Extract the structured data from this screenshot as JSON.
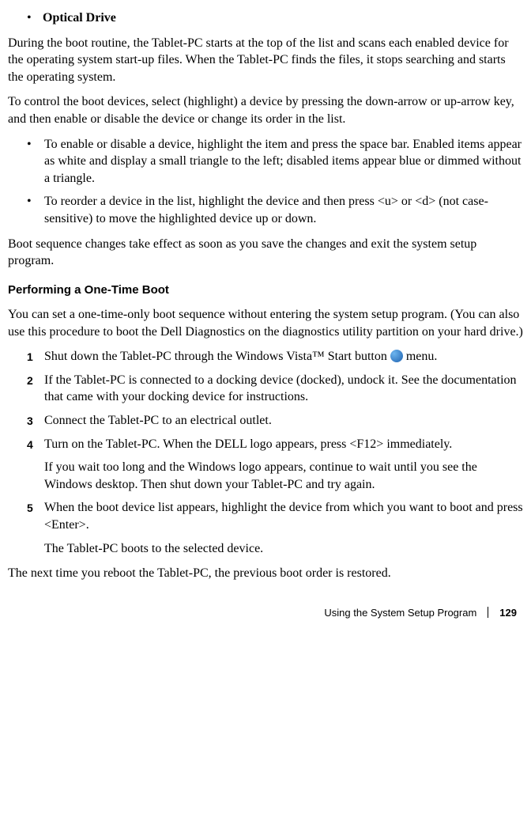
{
  "top_bullet": {
    "marker": "•",
    "label": "Optical Drive"
  },
  "p1": "During the boot routine, the Tablet-PC starts at the top of the list and scans each enabled device for the operating system start-up files. When the Tablet-PC finds the files, it stops searching and starts the operating system.",
  "p2": "To control the boot devices, select (highlight) a device by pressing the down-arrow or up-arrow key, and then enable or disable the device or change its order in the list.",
  "sub_bullets": [
    "To enable or disable a device, highlight the item and press the space bar. Enabled items appear as white and display a small triangle to the left; disabled items appear blue or dimmed without a triangle.",
    "To reorder a device in the list, highlight the device and then press <u> or <d> (not case-sensitive) to move the highlighted device up or down."
  ],
  "p3": "Boot sequence changes take effect as soon as you save the changes and exit the system setup program.",
  "heading": "Performing a One-Time Boot",
  "p4": "You can set a one-time-only boot sequence without entering the system setup program. (You can also use this procedure to boot the Dell Diagnostics on the diagnostics utility partition on your hard drive.)",
  "steps": [
    {
      "num": "1",
      "text_before_icon": "Shut down the Tablet-PC through the Windows Vista™ Start button ",
      "text_after_icon": " menu."
    },
    {
      "num": "2",
      "text": "If the Tablet-PC is connected to a docking device (docked), undock it. See the documentation that came with your docking device for instructions."
    },
    {
      "num": "3",
      "text": "Connect the Tablet-PC to an electrical outlet."
    },
    {
      "num": "4",
      "text": "Turn on the Tablet-PC. When the DELL logo appears, press <F12> immediately.",
      "cont": "If you wait too long and the Windows logo appears, continue to wait until you see the Windows desktop. Then shut down your Tablet-PC and try again."
    },
    {
      "num": "5",
      "text": "When the boot device list appears, highlight the device from which you want to boot and press <Enter>.",
      "cont": "The Tablet-PC boots to the selected device."
    }
  ],
  "p5": "The next time you reboot the Tablet-PC, the previous boot order is restored.",
  "footer": {
    "title": "Using the System Setup Program",
    "page": "129"
  }
}
